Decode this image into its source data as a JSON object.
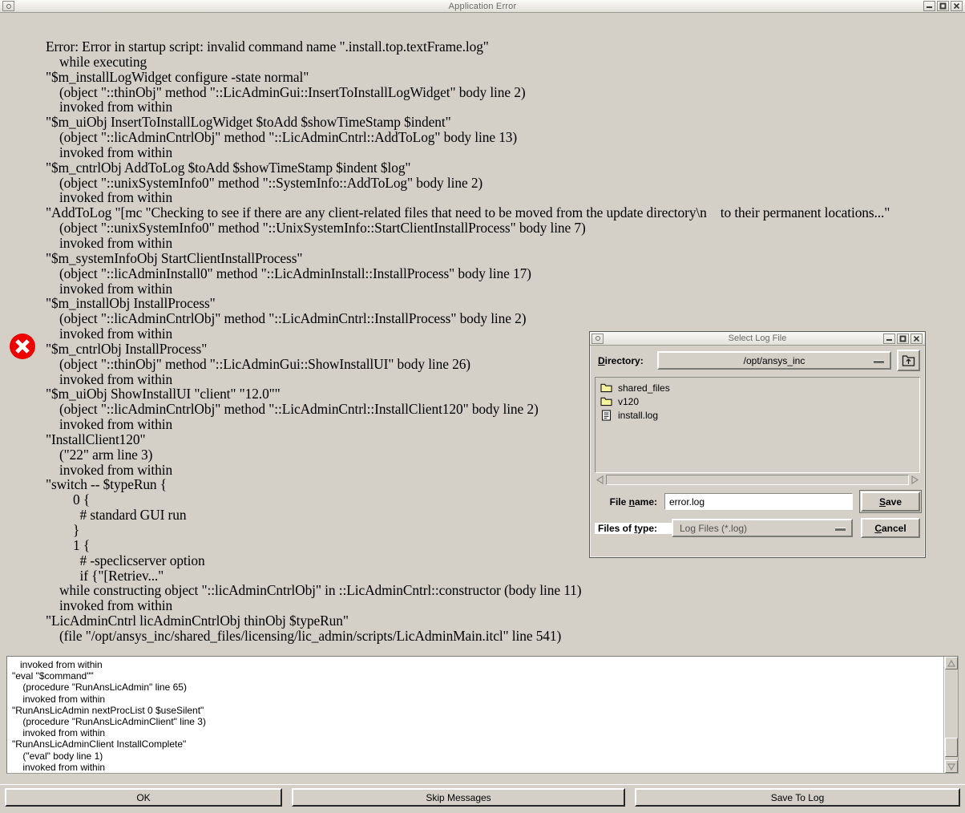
{
  "window": {
    "title": "Application Error",
    "icon": "window-menu-icon",
    "buttons": [
      {
        "name": "minimize",
        "glyph": "minimize-icon"
      },
      {
        "name": "maximize",
        "glyph": "maximize-icon"
      },
      {
        "name": "close",
        "glyph": "close-icon"
      }
    ]
  },
  "error": {
    "icon": "error-cross-icon",
    "text": "Error: Error in startup script: invalid command name \".install.top.textFrame.log\"\n    while executing\n\"$m_installLogWidget configure -state normal\"\n    (object \"::thinObj\" method \"::LicAdminGui::InsertToInstallLogWidget\" body line 2)\n    invoked from within\n\"$m_uiObj InsertToInstallLogWidget $toAdd $showTimeStamp $indent\"\n    (object \"::licAdminCntrlObj\" method \"::LicAdminCntrl::AddToLog\" body line 13)\n    invoked from within\n\"$m_cntrlObj AddToLog $toAdd $showTimeStamp $indent $log\"\n    (object \"::unixSystemInfo0\" method \"::SystemInfo::AddToLog\" body line 2)\n    invoked from within\n\"AddToLog \"[mc \"Checking to see if there are any client-related files that need to be moved from the update directory\\n    to their permanent locations...\"\n    (object \"::unixSystemInfo0\" method \"::UnixSystemInfo::StartClientInstallProcess\" body line 7)\n    invoked from within\n\"$m_systemInfoObj StartClientInstallProcess\"\n    (object \"::licAdminInstall0\" method \"::LicAdminInstall::InstallProcess\" body line 17)\n    invoked from within\n\"$m_installObj InstallProcess\"\n    (object \"::licAdminCntrlObj\" method \"::LicAdminCntrl::InstallProcess\" body line 2)\n    invoked from within\n\"$m_cntrlObj InstallProcess\"\n    (object \"::thinObj\" method \"::LicAdminGui::ShowInstallUI\" body line 26)\n    invoked from within\n\"$m_uiObj ShowInstallUI \"client\" \"12.0\"\"\n    (object \"::licAdminCntrlObj\" method \"::LicAdminCntrl::InstallClient120\" body line 2)\n    invoked from within\n\"InstallClient120\"\n    (\"22\" arm line 3)\n    invoked from within\n\"switch -- $typeRun {\n        0 {\n          # standard GUI run\n        }\n        1 {\n          # -speclicserver option\n          if {\"[Retriev...\"\n    while constructing object \"::licAdminCntrlObj\" in ::LicAdminCntrl::constructor (body line 11)\n    invoked from within\n\"LicAdminCntrl licAdminCntrlObj thinObj $typeRun\"\n    (file \"/opt/ansys_inc/shared_files/licensing/lic_admin/scripts/LicAdminMain.itcl\" line 541)"
  },
  "log_panel": {
    "text": "   invoked from within\n\"eval \"$command\"\"\n    (procedure \"RunAnsLicAdmin\" line 65)\n    invoked from within\n\"RunAnsLicAdmin nextProcList 0 $useSilent\"\n    (procedure \"RunAnsLicAdminClient\" line 3)\n    invoked from within\n\"RunAnsLicAdminClient InstallComplete\"\n    (\"eval\" body line 1)\n    invoked from within",
    "scrollbar": {
      "up_icon": "scroll-up-arrow-icon",
      "down_icon": "scroll-down-arrow-icon"
    }
  },
  "buttons": {
    "ok": "OK",
    "skip": "Skip Messages",
    "save_to_log": "Save To Log"
  },
  "dialog": {
    "title": "Select Log File",
    "icon": "window-menu-icon",
    "window_buttons": [
      {
        "name": "minimize",
        "glyph": "minimize-icon"
      },
      {
        "name": "maximize",
        "glyph": "maximize-icon"
      },
      {
        "name": "close",
        "glyph": "close-icon"
      }
    ],
    "directory_label": "Directory:",
    "directory_label_mnemonic": "D",
    "directory_value": "/opt/ansys_inc",
    "updir_icon": "up-directory-folder-icon",
    "files": [
      {
        "name": "shared_files",
        "type": "folder",
        "icon": "folder-icon"
      },
      {
        "name": "v120",
        "type": "folder",
        "icon": "folder-icon"
      },
      {
        "name": "install.log",
        "type": "file",
        "icon": "document-icon"
      }
    ],
    "filename_label": "File name:",
    "filename_label_mnemonic": "n",
    "filename_value": "error.log",
    "filetype_label": "Files of type:",
    "filetype_label_mnemonic": "t",
    "filetype_value": "Log Files (*.log)",
    "save_label": "Save",
    "save_mnemonic": "S",
    "cancel_label": "Cancel",
    "cancel_mnemonic": "C"
  },
  "colors": {
    "window_bg": "#d4d0c8",
    "error_red": "#ee0000",
    "folder_yellow": "#f7f4a0",
    "titlebar_text": "#6a6a66"
  }
}
